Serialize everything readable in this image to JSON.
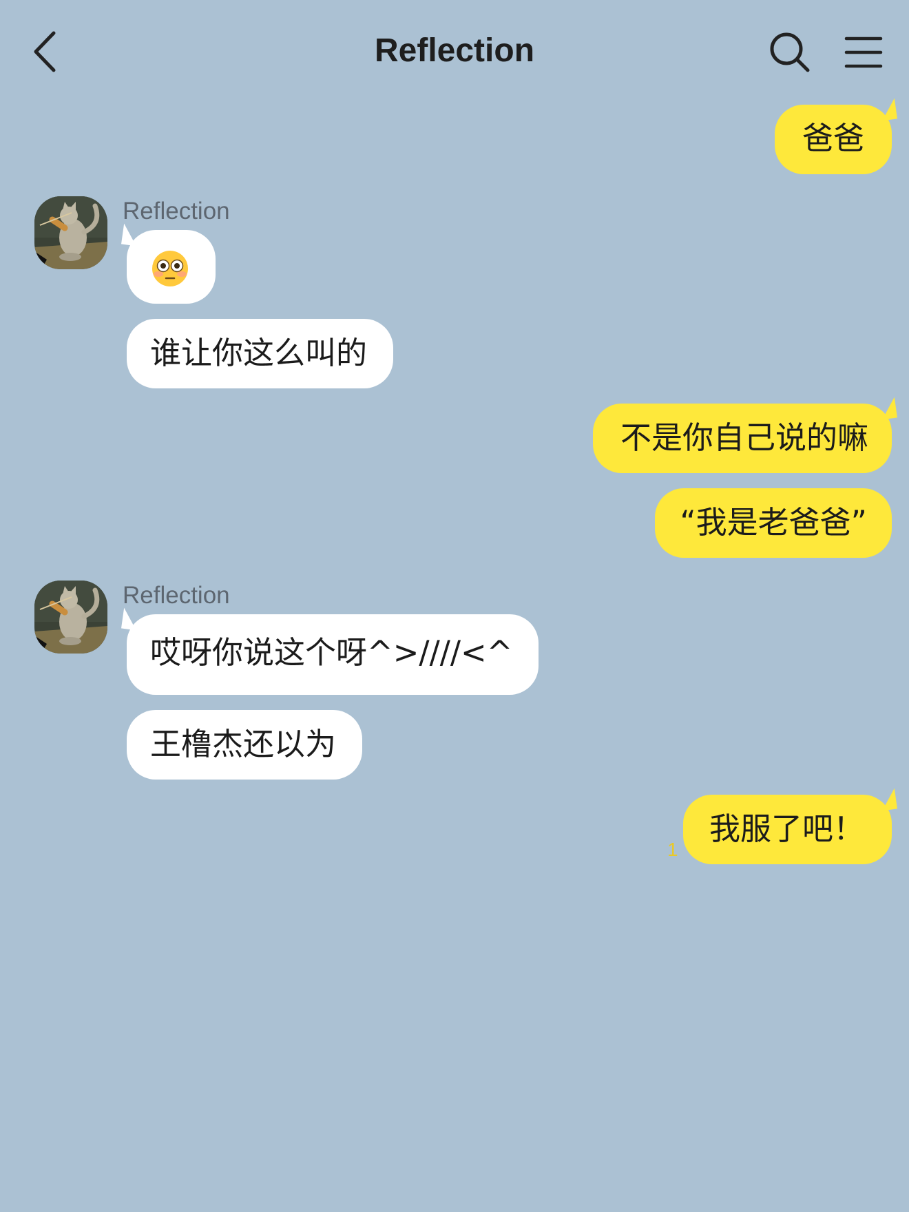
{
  "header": {
    "title": "Reflection",
    "back_icon": "chevron-left-icon",
    "search_icon": "search-icon",
    "menu_icon": "hamburger-menu-icon"
  },
  "colors": {
    "background": "#abc1d3",
    "my_bubble": "#fee83b",
    "their_bubble": "#ffffff",
    "unread_count": "#e9c928"
  },
  "messages": [
    {
      "from": "me",
      "text": "爸爸"
    },
    {
      "from": "them",
      "sender": "Reflection",
      "emoji": "flushed-face-emoji"
    },
    {
      "from": "them",
      "text": "谁让你这么叫的"
    },
    {
      "from": "me",
      "text": "不是你自己说的嘛"
    },
    {
      "from": "me",
      "text": "“我是老爸爸”"
    },
    {
      "from": "them",
      "sender": "Reflection",
      "text": "哎呀你说这个呀^>////<^"
    },
    {
      "from": "them",
      "text": "王橹杰还以为"
    },
    {
      "from": "me",
      "text": "我服了吧！",
      "unread": "1"
    }
  ]
}
